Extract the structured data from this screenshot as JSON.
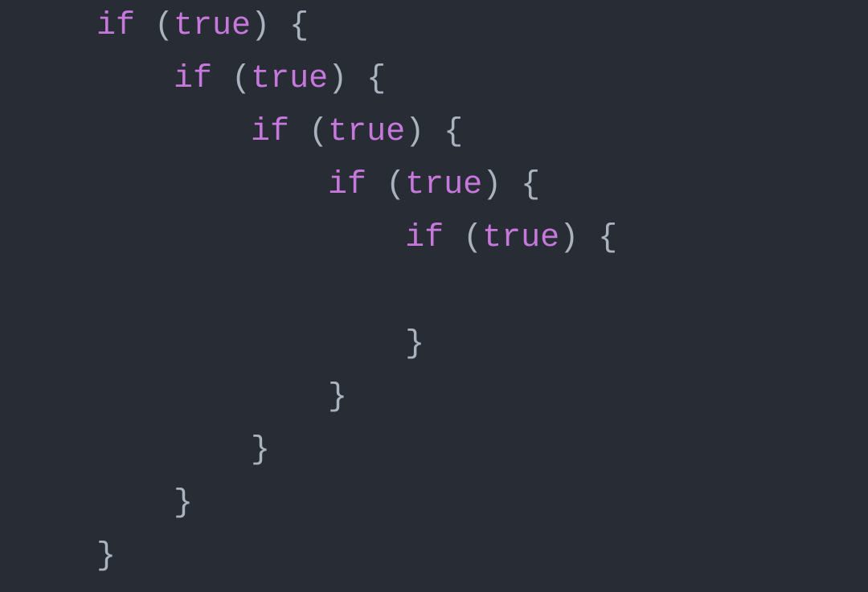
{
  "syntax": {
    "keyword_if": "if",
    "value_true": "true",
    "paren_open": "(",
    "paren_close": ")",
    "brace_open": "{",
    "brace_close": "}",
    "space": " "
  },
  "indentation": {
    "level0": "",
    "level1": "    ",
    "level2": "        ",
    "level3": "            ",
    "level4": "                "
  },
  "colors": {
    "background": "#282c34",
    "keyword": "#c678dd",
    "punctuation": "#abb2bf",
    "value": "#c678dd"
  }
}
